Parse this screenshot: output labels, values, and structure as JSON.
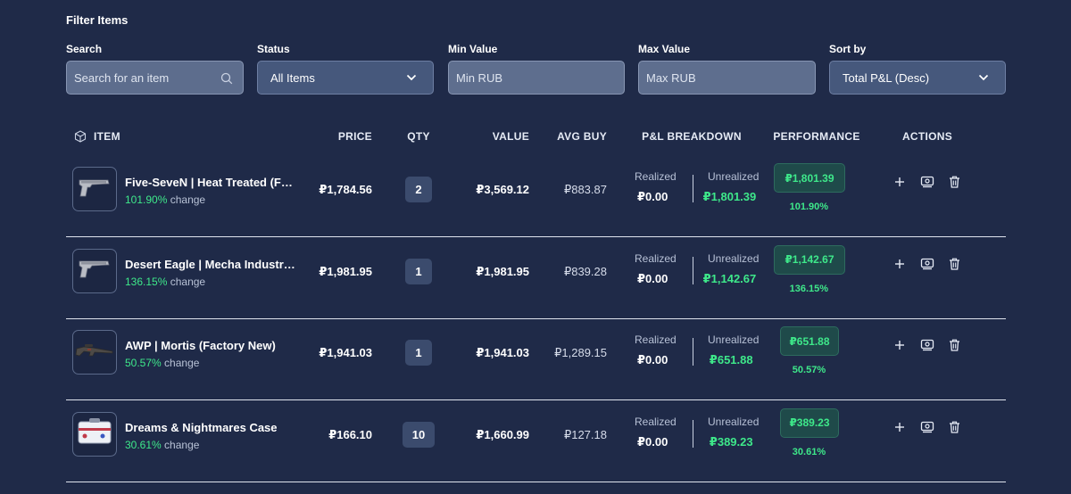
{
  "filters": {
    "title": "Filter Items",
    "search": {
      "label": "Search",
      "placeholder": "Search for an item"
    },
    "status": {
      "label": "Status",
      "value": "All Items"
    },
    "min_value": {
      "label": "Min Value",
      "placeholder": "Min RUB"
    },
    "max_value": {
      "label": "Max Value",
      "placeholder": "Max RUB"
    },
    "sort": {
      "label": "Sort by",
      "value": "Total P&L (Desc)"
    }
  },
  "table": {
    "headers": {
      "item": "ITEM",
      "price": "PRICE",
      "qty": "QTY",
      "value": "VALUE",
      "avg_buy": "AVG BUY",
      "pl_breakdown": "P&L BREAKDOWN",
      "performance": "PERFORMANCE",
      "actions": "ACTIONS"
    },
    "realized_label": "Realized",
    "unrealized_label": "Unrealized",
    "change_suffix": "change",
    "rows": [
      {
        "name": "Five-SeveN | Heat Treated (F…",
        "change": "101.90%",
        "price": "₽1,784.56",
        "qty": "2",
        "value": "₽3,569.12",
        "avg_buy": "₽883.87",
        "realized": "₽0.00",
        "unrealized": "₽1,801.39",
        "performance": "₽1,801.39",
        "performance_pct": "101.90%",
        "icon": "pistol-icon"
      },
      {
        "name": "Desert Eagle | Mecha Industr…",
        "change": "136.15%",
        "price": "₽1,981.95",
        "qty": "1",
        "value": "₽1,981.95",
        "avg_buy": "₽839.28",
        "realized": "₽0.00",
        "unrealized": "₽1,142.67",
        "performance": "₽1,142.67",
        "performance_pct": "136.15%",
        "icon": "pistol-icon"
      },
      {
        "name": "AWP | Mortis (Factory New)",
        "change": "50.57%",
        "price": "₽1,941.03",
        "qty": "1",
        "value": "₽1,941.03",
        "avg_buy": "₽1,289.15",
        "realized": "₽0.00",
        "unrealized": "₽651.88",
        "performance": "₽651.88",
        "performance_pct": "50.57%",
        "icon": "rifle-icon"
      },
      {
        "name": "Dreams & Nightmares Case",
        "change": "30.61%",
        "price": "₽166.10",
        "qty": "10",
        "value": "₽1,660.99",
        "avg_buy": "₽127.18",
        "realized": "₽0.00",
        "unrealized": "₽389.23",
        "performance": "₽389.23",
        "performance_pct": "30.61%",
        "icon": "case-icon"
      }
    ]
  }
}
